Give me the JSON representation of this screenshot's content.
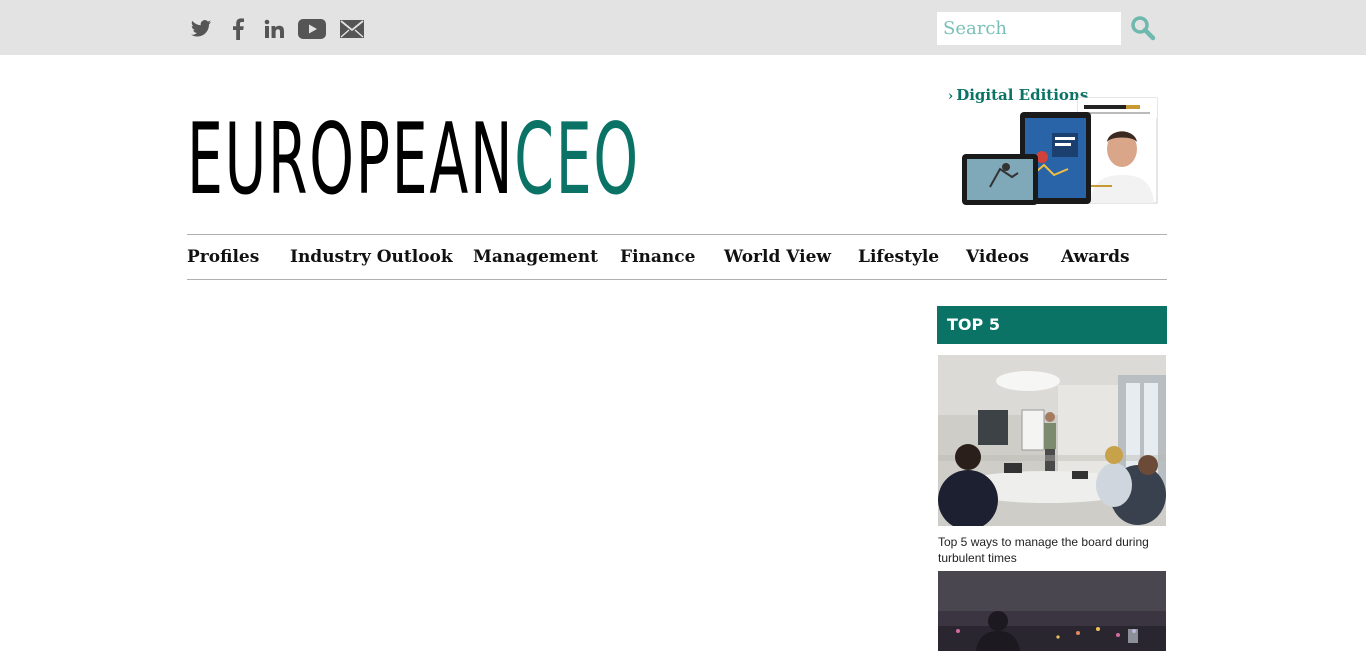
{
  "topbar": {
    "social_icons": [
      "twitter-icon",
      "facebook-icon",
      "linkedin-icon",
      "youtube-icon",
      "email-icon"
    ],
    "search": {
      "placeholder": "Search",
      "value": ""
    },
    "search_icon": "search-icon"
  },
  "logo": {
    "part1": "EUROPEAN",
    "part2": "CEO"
  },
  "digital_editions": {
    "label": "Digital Editions",
    "chevron": "›"
  },
  "nav": {
    "items": [
      {
        "label": "Profiles"
      },
      {
        "label": "Industry Outlook"
      },
      {
        "label": "Management"
      },
      {
        "label": "Finance"
      },
      {
        "label": "World View"
      },
      {
        "label": "Lifestyle"
      },
      {
        "label": "Videos"
      },
      {
        "label": "Awards"
      }
    ]
  },
  "sidebar": {
    "top5_title": "TOP 5",
    "articles": [
      {
        "caption": "Top 5 ways to manage the board during turbulent times"
      }
    ]
  },
  "colors": {
    "brand": "#0b7366",
    "topbar_bg": "#e3e3e3",
    "search_icon": "#6fb8ae"
  }
}
